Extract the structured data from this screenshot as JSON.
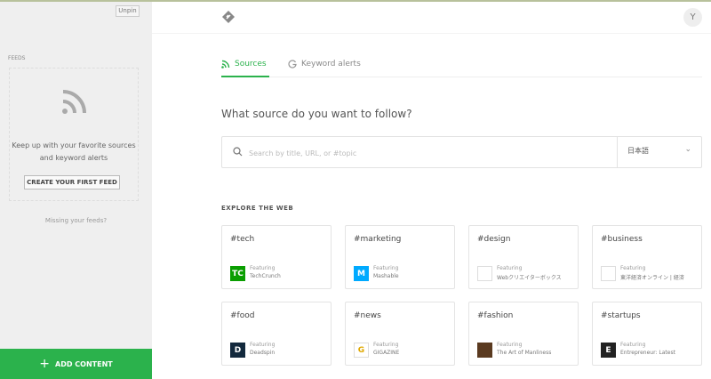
{
  "sidebar": {
    "unpin": "Unpin",
    "feeds_label": "FEEDS",
    "empty_line1": "Keep up with your favorite sources",
    "empty_line2": "and keyword alerts",
    "create_button": "CREATE YOUR FIRST FEED",
    "missing": "Missing your feeds?",
    "add_content": "ADD CONTENT",
    "add_icon": "+"
  },
  "header": {
    "avatar": "Y"
  },
  "tabs": [
    {
      "label": "Sources",
      "icon": "rss-icon",
      "active": true
    },
    {
      "label": "Keyword alerts",
      "icon": "google-icon",
      "active": false
    }
  ],
  "question": "What source do you want to follow?",
  "search": {
    "placeholder": "Search by title, URL, or #topic",
    "value": "",
    "language": "日本語"
  },
  "explore": {
    "title": "EXPLORE THE WEB",
    "featuring": "Featuring",
    "cards": [
      {
        "tag": "#tech",
        "source": "TechCrunch",
        "icon_text": "TC",
        "color": "#0a9e01"
      },
      {
        "tag": "#marketing",
        "source": "Mashable",
        "icon_text": "M",
        "color": "#00aaff"
      },
      {
        "tag": "#design",
        "source": "Webクリエイターボックス",
        "icon_text": "",
        "color": "#ffffff"
      },
      {
        "tag": "#business",
        "source": "東洋経済オンライン | 経済",
        "icon_text": "",
        "color": "#ffffff"
      },
      {
        "tag": "#food",
        "source": "Deadspin",
        "icon_text": "D",
        "color": "#13293d"
      },
      {
        "tag": "#news",
        "source": "GIGAZINE",
        "icon_text": "G",
        "color": "#ffffff"
      },
      {
        "tag": "#fashion",
        "source": "The Art of Manliness",
        "icon_text": "",
        "color": "#5a3a20"
      },
      {
        "tag": "#startups",
        "source": "Entrepreneur: Latest",
        "icon_text": "E",
        "color": "#222222"
      }
    ]
  },
  "colors": {
    "accent": "#2bb24c"
  }
}
